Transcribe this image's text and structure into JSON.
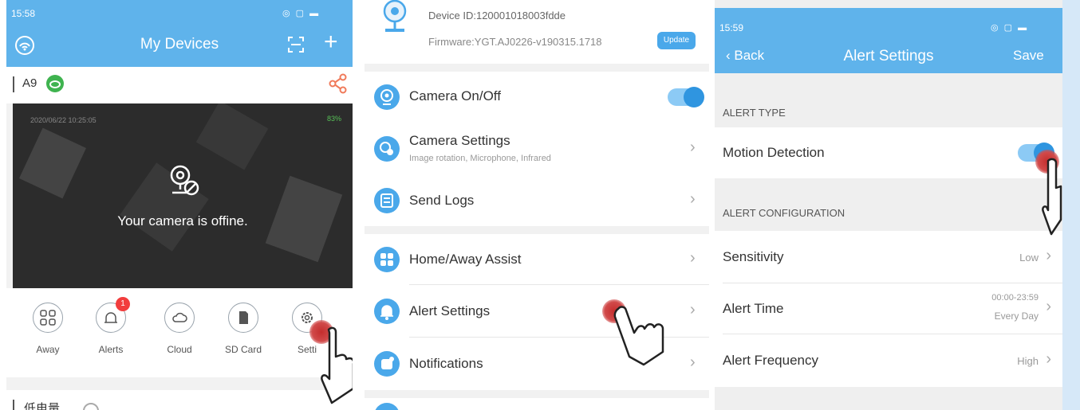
{
  "panel1": {
    "status_time": "15:58",
    "title": "My Devices",
    "device_name": "A9",
    "camera_timestamp": "2020/06/22 10:25:05",
    "camera_battery": "83%",
    "offline_text": "Your camera is offine.",
    "actions": [
      {
        "label": "Away",
        "icon": "away-icon"
      },
      {
        "label": "Alerts",
        "icon": "alerts-icon",
        "badge": "1"
      },
      {
        "label": "Cloud",
        "icon": "cloud-icon"
      },
      {
        "label": "SD Card",
        "icon": "sd-card-icon"
      },
      {
        "label": "Setti",
        "icon": "settings-icon"
      }
    ],
    "second_device_name": "低电量"
  },
  "panel2": {
    "device_id": "Device ID:120001018003fdde",
    "firmware": "Firmware:YGT.AJ0226-v190315.1718",
    "update_label": "Update",
    "rows": [
      {
        "title": "Camera On/Off",
        "subtitle": ""
      },
      {
        "title": "Camera Settings",
        "subtitle": "Image rotation, Microphone, Infrared"
      },
      {
        "title": "Send Logs",
        "subtitle": ""
      },
      {
        "title": "Home/Away Assist",
        "subtitle": ""
      },
      {
        "title": "Alert Settings",
        "subtitle": ""
      },
      {
        "title": "Notifications",
        "subtitle": ""
      }
    ]
  },
  "panel3": {
    "status_time": "15:59",
    "back_label": "Back",
    "title": "Alert Settings",
    "save_label": "Save",
    "section1": "ALERT TYPE",
    "motion_label": "Motion Detection",
    "motion_on": true,
    "section2": "ALERT CONFIGURATION",
    "sensitivity_label": "Sensitivity",
    "sensitivity_value": "Low",
    "alert_time_label": "Alert Time",
    "alert_time_range": "00:00-23:59",
    "alert_time_days": "Every Day",
    "frequency_label": "Alert Frequency",
    "frequency_value": "High"
  },
  "colors": {
    "header_blue": "#5fb3eb",
    "accent_blue": "#4aa8ea",
    "badge_red": "#f23d3d",
    "cloud_green": "#3fb34f"
  }
}
